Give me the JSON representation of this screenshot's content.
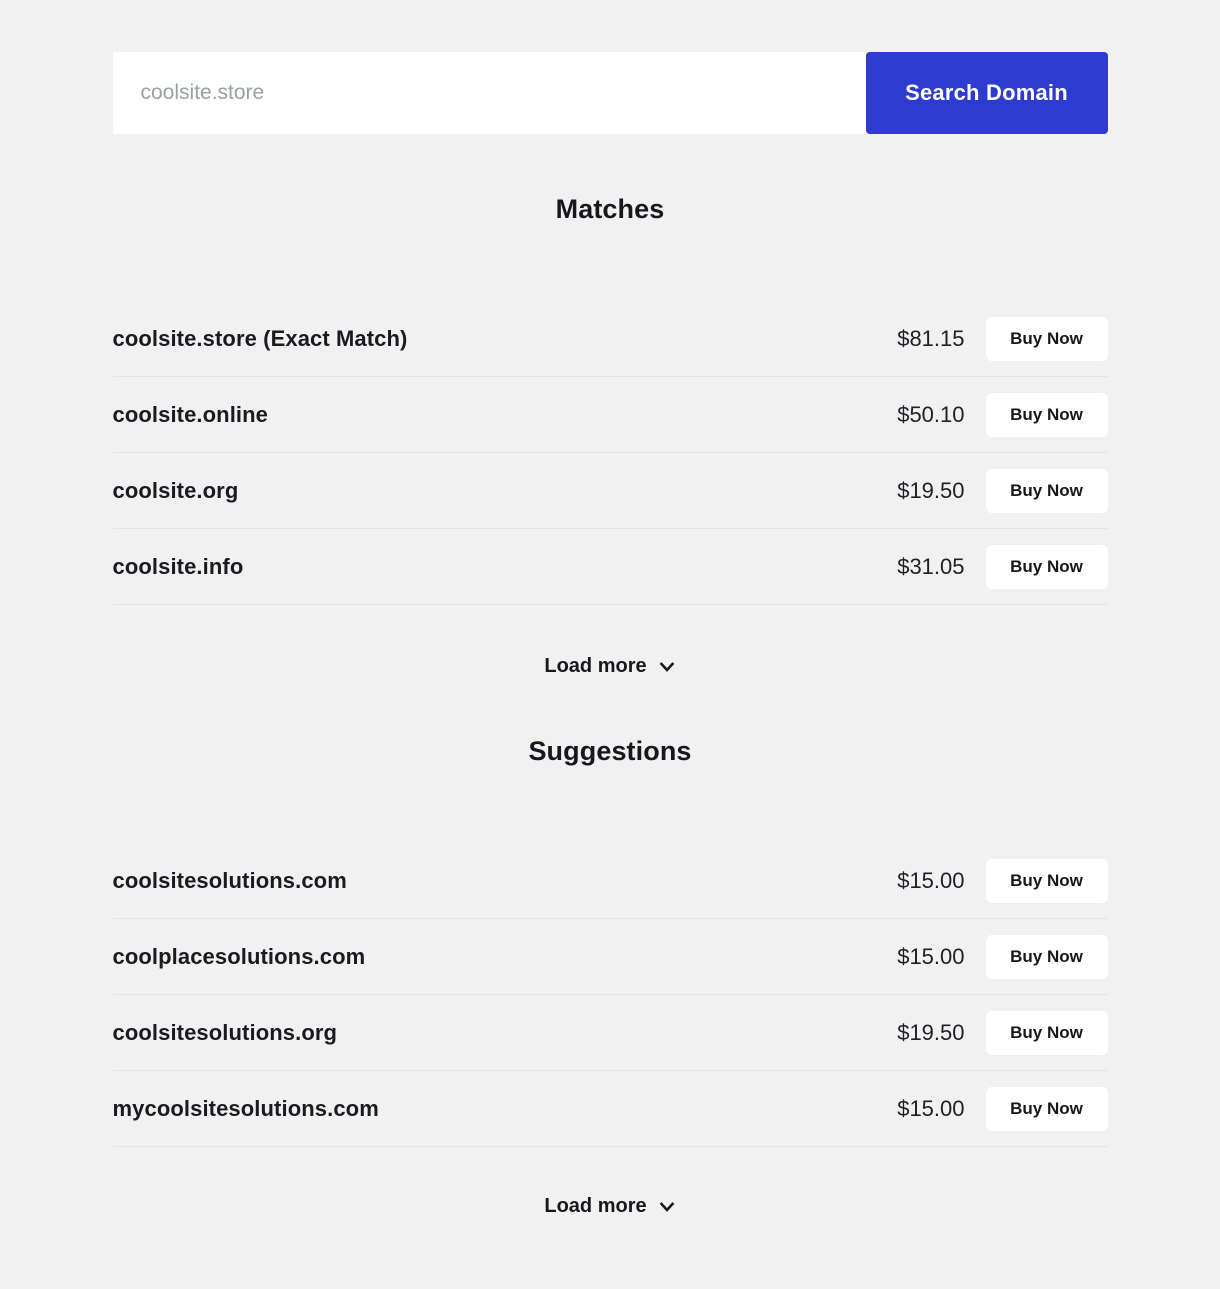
{
  "theme": {
    "page_background": "#f1f1f1",
    "accent": "#2e3bd0",
    "text": "#16181d",
    "divider": "#e4e4e4",
    "placeholder": "#9aa0a6",
    "card": "#ffffff"
  },
  "search": {
    "placeholder": "coolsite.store",
    "value": "",
    "button_label": "Search Domain"
  },
  "matches": {
    "title": "Matches",
    "rows": [
      {
        "name": "coolsite.store (Exact Match)",
        "price": "$81.15",
        "buy_label": "Buy Now"
      },
      {
        "name": "coolsite.online",
        "price": "$50.10",
        "buy_label": "Buy Now"
      },
      {
        "name": "coolsite.org",
        "price": "$19.50",
        "buy_label": "Buy Now"
      },
      {
        "name": "coolsite.info",
        "price": "$31.05",
        "buy_label": "Buy Now"
      }
    ],
    "load_more_label": "Load more",
    "load_more_icon": "chevron-down-icon"
  },
  "suggestions": {
    "title": "Suggestions",
    "rows": [
      {
        "name": "coolsitesolutions.com",
        "price": "$15.00",
        "buy_label": "Buy Now"
      },
      {
        "name": "coolplacesolutions.com",
        "price": "$15.00",
        "buy_label": "Buy Now"
      },
      {
        "name": "coolsitesolutions.org",
        "price": "$19.50",
        "buy_label": "Buy Now"
      },
      {
        "name": "mycoolsitesolutions.com",
        "price": "$15.00",
        "buy_label": "Buy Now"
      }
    ],
    "load_more_label": "Load more",
    "load_more_icon": "chevron-down-icon"
  }
}
